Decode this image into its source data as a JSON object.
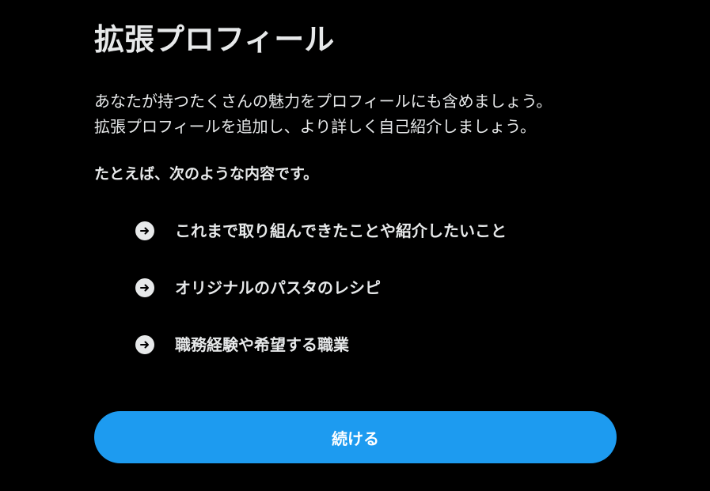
{
  "title": "拡張プロフィール",
  "intro": {
    "line1": "あなたが持つたくさんの魅力をプロフィールにも含めましょう。",
    "line2": "拡張プロフィールを追加し、より詳しく自己紹介しましょう。"
  },
  "lead": "たとえば、次のような内容です。",
  "features": [
    {
      "label": "これまで取り組んできたことや紹介したいこと",
      "icon": "arrow-right-circle-icon"
    },
    {
      "label": "オリジナルのパスタのレシピ",
      "icon": "arrow-right-circle-icon"
    },
    {
      "label": "職務経験や希望する職業",
      "icon": "arrow-right-circle-icon"
    }
  ],
  "continue_label": "続ける",
  "colors": {
    "background": "#000000",
    "text": "#e7e9ea",
    "accent": "#1d9bf0"
  }
}
